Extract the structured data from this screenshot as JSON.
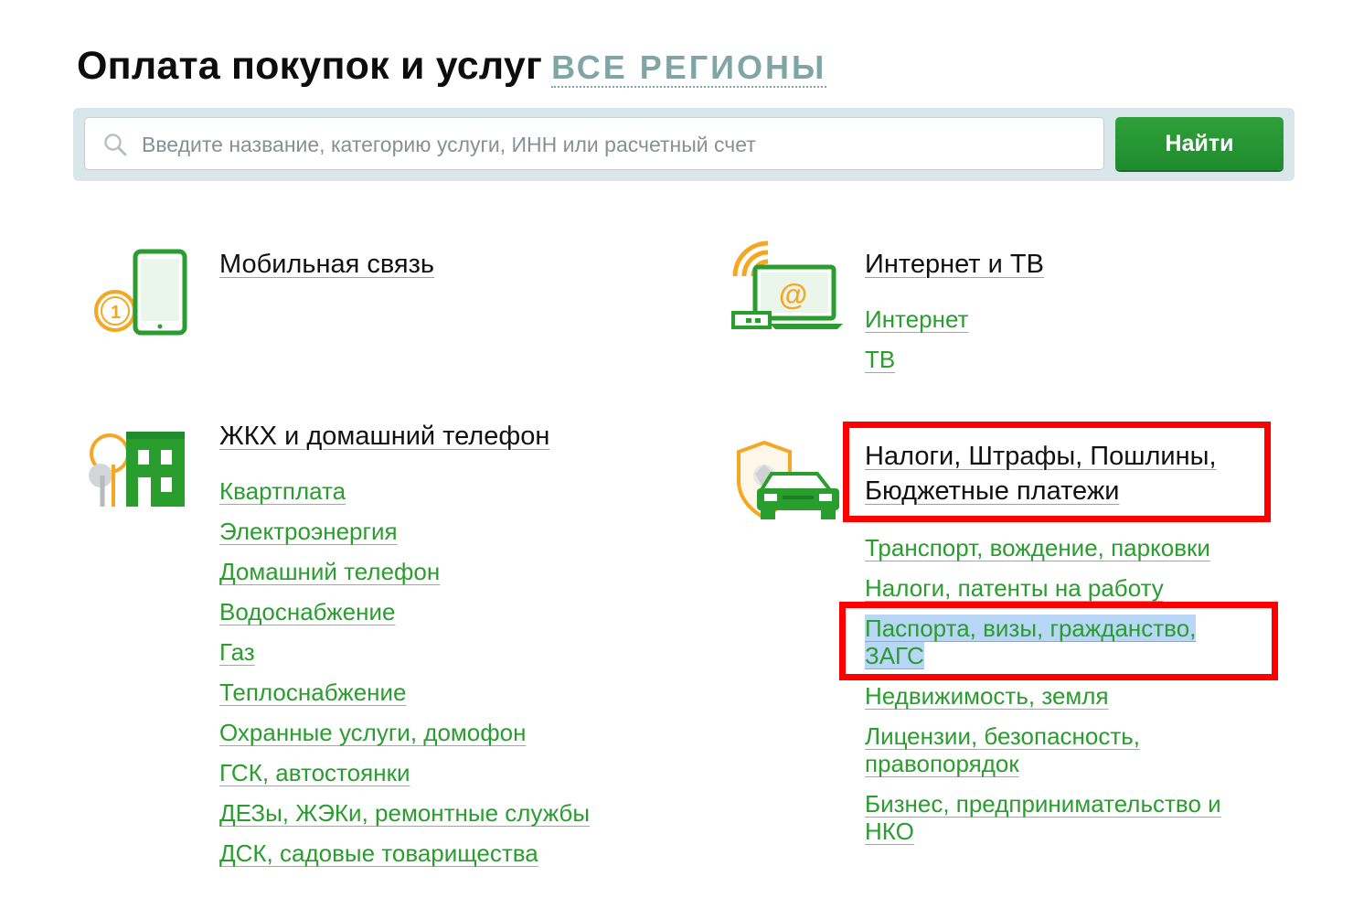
{
  "header": {
    "title": "Оплата покупок и услуг",
    "region_link": "ВСЕ РЕГИОНЫ"
  },
  "search": {
    "placeholder": "Введите название, категорию услуги, ИНН или расчетный счет",
    "value": "",
    "button_label": "Найти"
  },
  "colors": {
    "accent_green": "#2a9d2f",
    "button_green": "#21952f",
    "icon_orange": "#f5a623",
    "region_link": "#7fa6a4",
    "annotation_red": "#ff0000",
    "selection_blue": "#b8d6f5"
  },
  "categories": {
    "mobile": {
      "title": "Мобильная связь",
      "icon": "mobile-phone-icon",
      "links": []
    },
    "internet": {
      "title": "Интернет и ТВ",
      "icon": "laptop-wifi-icon",
      "links": [
        "Интернет",
        "ТВ"
      ]
    },
    "housing": {
      "title": "ЖКХ и домашний телефон",
      "icon": "house-tree-icon",
      "links": [
        "Квартплата",
        "Электроэнергия",
        "Домашний телефон",
        "Водоснабжение",
        "Газ",
        "Теплоснабжение",
        "Охранные услуги, домофон",
        "ГСК, автостоянки",
        "ДЕЗы, ЖЭКи, ремонтные службы",
        "ДСК, садовые товарищества"
      ]
    },
    "taxes": {
      "title_line1": "Налоги, Штрафы, Пошлины,",
      "title_line2": "Бюджетные платежи",
      "icon": "car-shield-icon",
      "links": [
        "Транспорт, вождение, парковки",
        "Налоги, патенты на работу",
        "Паспорта, визы, гражданство,",
        "ЗАГС",
        "Недвижимость, земля",
        "Лицензии, безопасность,",
        "правопорядок",
        "Бизнес, предпринимательство и",
        "НКО"
      ]
    }
  }
}
